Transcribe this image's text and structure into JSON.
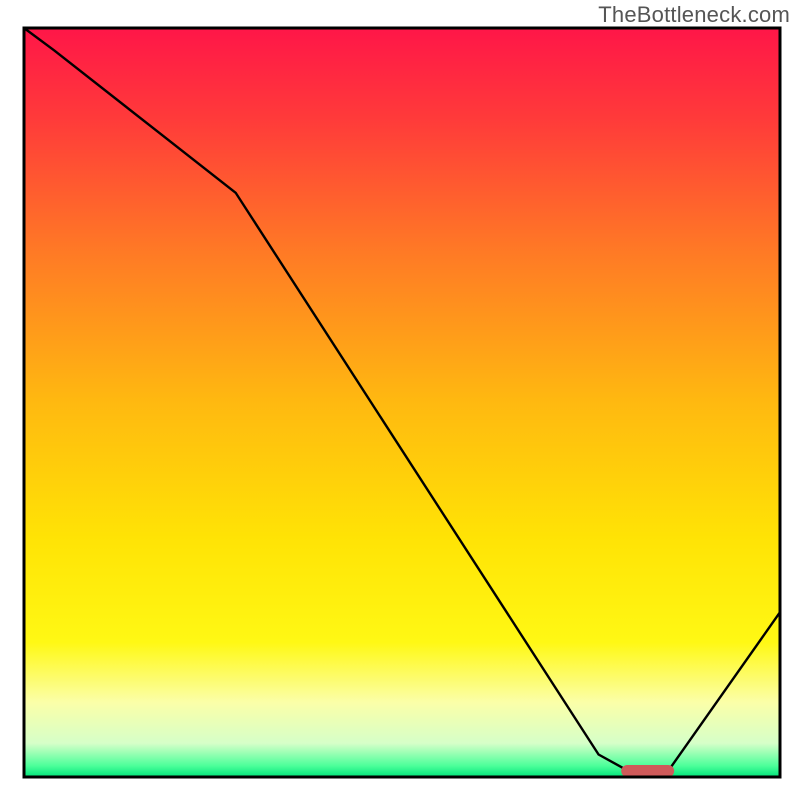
{
  "watermark": "TheBottleneck.com",
  "chart_data": {
    "type": "line",
    "title": "",
    "xlabel": "",
    "ylabel": "",
    "xlim": [
      0,
      100
    ],
    "ylim": [
      0,
      100
    ],
    "grid": false,
    "x": [
      0,
      4,
      28,
      76,
      80.5,
      85,
      100
    ],
    "values": [
      100,
      97,
      78,
      3,
      0.5,
      0.5,
      22
    ],
    "marker": {
      "shape": "rounded-bar",
      "x_start": 79,
      "x_end": 86,
      "y": 0.8,
      "color": "#cf5a5a"
    },
    "background_gradient_stops": [
      {
        "offset": 0.0,
        "color": "#ff1648"
      },
      {
        "offset": 0.12,
        "color": "#ff3a3a"
      },
      {
        "offset": 0.3,
        "color": "#ff7a25"
      },
      {
        "offset": 0.5,
        "color": "#ffb910"
      },
      {
        "offset": 0.68,
        "color": "#ffe305"
      },
      {
        "offset": 0.82,
        "color": "#fff814"
      },
      {
        "offset": 0.9,
        "color": "#fbffa8"
      },
      {
        "offset": 0.955,
        "color": "#d6ffc8"
      },
      {
        "offset": 0.985,
        "color": "#4cff9a"
      },
      {
        "offset": 1.0,
        "color": "#00e47a"
      }
    ],
    "line_color": "#000000",
    "border_color": "#000000"
  }
}
